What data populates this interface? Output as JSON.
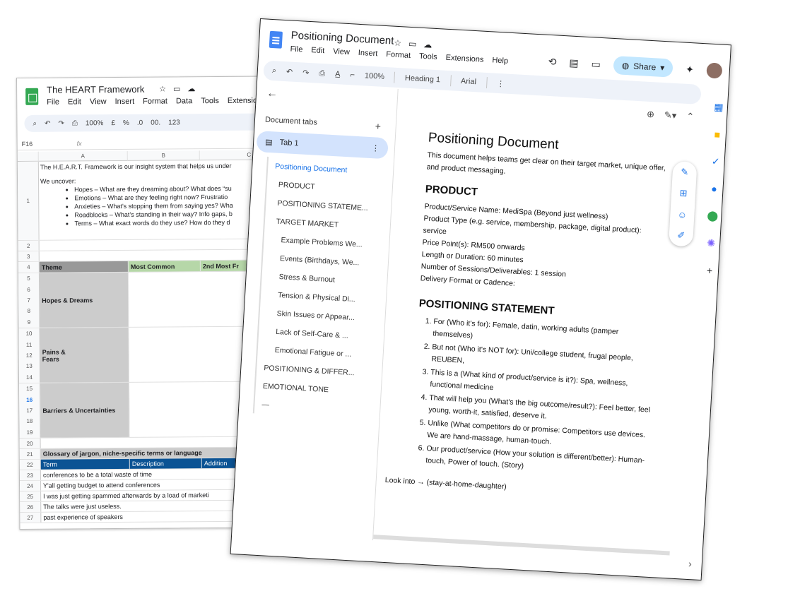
{
  "sheet": {
    "title": "The HEART Framework",
    "menu": [
      "File",
      "Edit",
      "View",
      "Insert",
      "Format",
      "Data",
      "Tools",
      "Extensions"
    ],
    "toolbar": [
      "100%",
      "£",
      "%",
      ".0",
      "00.",
      "123"
    ],
    "name_box": "F16",
    "fx": "fx",
    "columns": [
      "A",
      "B",
      "C"
    ],
    "intro": {
      "line1": "The H.E.A.R.T. Framework is our insight system that helps us under",
      "line2": "We uncover:",
      "bullets": [
        "Hopes – What are they dreaming about? What does “su",
        "Emotions – What are they feeling right now? Frustratio",
        "Anxieties – What’s stopping them from saying yes? Wha",
        "Roadblocks – What’s standing in their way? Info gaps, b",
        "Terms – What exact words do they use? How do they d"
      ]
    },
    "table_headers": [
      "Theme",
      "Most Common",
      "2nd Most Fr"
    ],
    "groups": [
      "Hopes & Dreams",
      "Pains &\nFears",
      "Barriers & Uncertainties"
    ],
    "glossary_title": "Glossary of jargon, niche-specific terms or language",
    "glossary_headers": [
      "Term",
      "Description",
      "Addition"
    ],
    "glossary_rows": [
      "conferences to be a total waste of time",
      "Y'all getting budget to attend conferences",
      "I was just getting spammed afterwards by a load of marketi",
      "The talks were just useless.",
      "past experience of speakers"
    ],
    "row_numbers": [
      "1",
      "2",
      "3",
      "4",
      "5",
      "6",
      "7",
      "8",
      "9",
      "10",
      "11",
      "12",
      "13",
      "14",
      "15",
      "16",
      "17",
      "18",
      "19",
      "20",
      "21",
      "22",
      "23",
      "24",
      "25",
      "26",
      "27"
    ]
  },
  "doc": {
    "title": "Positioning Document",
    "menu": [
      "File",
      "Edit",
      "View",
      "Insert",
      "Format",
      "Tools",
      "Extensions",
      "Help"
    ],
    "share_label": "Share",
    "toolbar": {
      "zoom": "100%",
      "style": "Heading 1",
      "font": "Arial"
    },
    "tabs_header": "Document tabs",
    "tab_label": "Tab 1",
    "outline": [
      "Positioning Document",
      "PRODUCT",
      "POSITIONING STATEME...",
      "TARGET MARKET",
      "Example Problems We...",
      "Events (Birthdays, We...",
      "Stress & Burnout",
      "Tension & Physical Di...",
      "Skin Issues or Appear...",
      "Lack of Self-Care & ...",
      "Emotional Fatigue or ...",
      "POSITIONING & DIFFER...",
      "EMOTIONAL TONE",
      "—"
    ],
    "page": {
      "h1": "Positioning Document",
      "intro": "This document helps teams get clear on their target market, unique offer, and product messaging.",
      "product_h": "PRODUCT",
      "product_lines": [
        "Product/Service Name: MediSpa (Beyond just wellness)",
        "Product Type (e.g. service, membership, package, digital product): service",
        "Price Point(s): RM500 onwards",
        "Length or Duration: 60 minutes",
        "Number of Sessions/Deliverables: 1 session",
        "Delivery Format or Cadence:"
      ],
      "positioning_h": "POSITIONING STATEMENT",
      "statements": [
        "For (Who it's for): Female, datin, working adults (pamper themselves)",
        "But not (Who it's NOT for): Uni/college student, frugal people, REUBEN,",
        "This is a (What kind of product/service is it?): Spa, wellness, functional medicine",
        "That will help you (What's the big outcome/result?): Feel better, feel young, worth-it, satisfied, deserve it.",
        "Unlike (What competitors do or promise: Competitors use devices. We are hand-massage, human-touch.",
        "Our product/service (How your solution is different/better): Human-touch, Power of touch. (Story)"
      ],
      "look_into": "Look into →  (stay-at-home-daughter)"
    }
  }
}
